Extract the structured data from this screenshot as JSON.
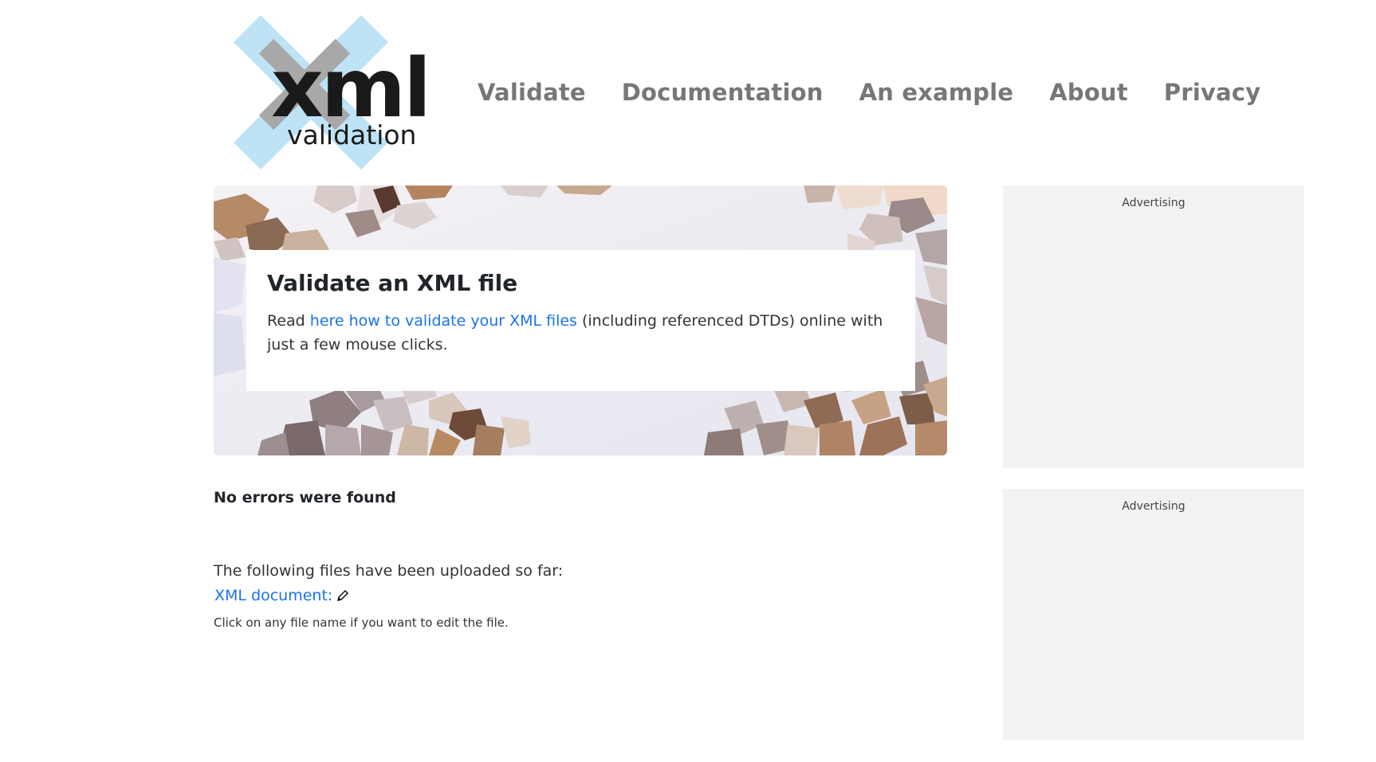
{
  "logo": {
    "word": "xml",
    "subword": "validation"
  },
  "nav": [
    {
      "label": "Validate"
    },
    {
      "label": "Documentation"
    },
    {
      "label": "An example"
    },
    {
      "label": "About"
    },
    {
      "label": "Privacy"
    }
  ],
  "hero": {
    "title": "Validate an XML file",
    "text_before": "Read ",
    "link": "here how to validate your XML files",
    "text_after": " (including referenced DTDs) online with just a few mouse clicks."
  },
  "result": {
    "heading": "No errors were found",
    "uploaded_note": "The following files have been uploaded so far:",
    "file_link": "XML document:",
    "hint": "Click on any file name if you want to edit the file."
  },
  "ads": [
    {
      "label": "Advertising"
    },
    {
      "label": "Advertising"
    }
  ],
  "colors": {
    "link": "#1a73e8",
    "nav": "#777777",
    "ad_background": "#f2f2f2",
    "logo_blue": "#bde3f5",
    "logo_gray": "#a8a8a8"
  },
  "icons": [
    "pencil-icon"
  ]
}
